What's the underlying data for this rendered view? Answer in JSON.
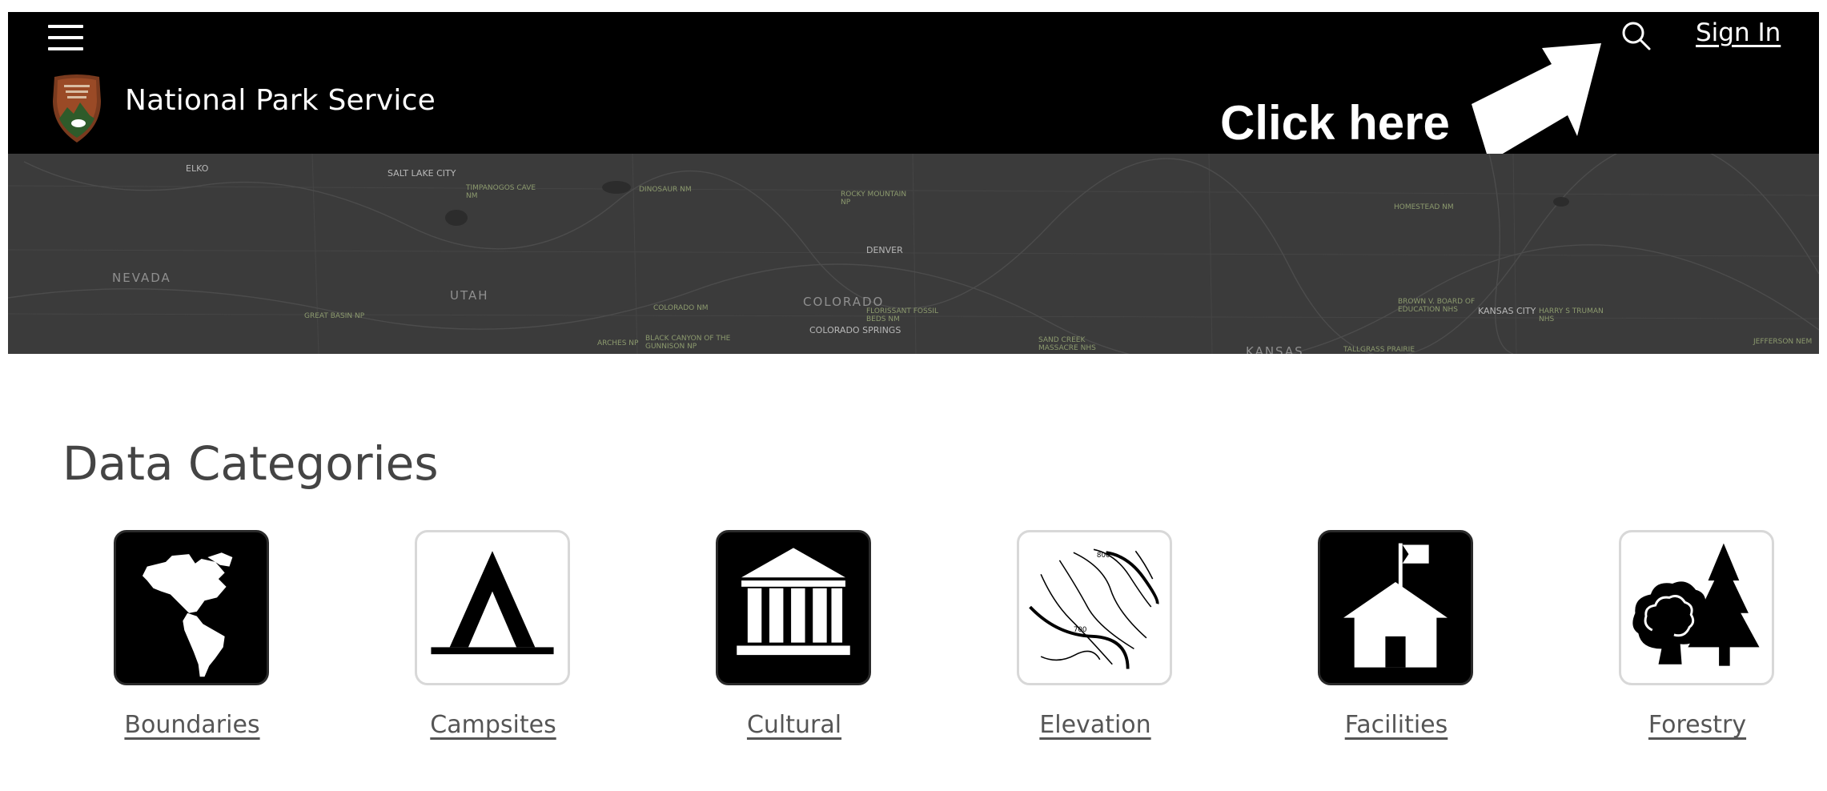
{
  "header": {
    "site_title": "National Park Service",
    "sign_in_label": "Sign In",
    "annotation_label": "Click here",
    "colors": {
      "background": "#000000",
      "text": "#ffffff"
    },
    "icons": [
      "menu-icon",
      "nps-arrowhead-logo",
      "search-icon",
      "arrow-pointer"
    ]
  },
  "map": {
    "state_labels": [
      "NEVADA",
      "UTAH",
      "COLORADO",
      "KANSAS"
    ],
    "city_labels": [
      "ELKO",
      "SALT LAKE CITY",
      "DENVER",
      "COLORADO SPRINGS",
      "KANSAS CITY"
    ],
    "park_labels": [
      "TIMPANOGOS CAVE NM",
      "DINOSAUR NM",
      "ROCKY MOUNTAIN NP",
      "HOMESTEAD NM",
      "GREAT BASIN NP",
      "COLORADO NM",
      "FLORISSANT FOSSIL BEDS NM",
      "BROWN V. BOARD OF EDUCATION NHS",
      "HARRY S TRUMAN NHS",
      "ARCHES NP",
      "BLACK CANYON OF THE GUNNISON NP",
      "SAND CREEK MASSACRE NHS",
      "TALLGRASS PRAIRIE",
      "JEFFERSON NEM"
    ],
    "colors": {
      "background": "#3b3b3b"
    }
  },
  "main": {
    "section_title": "Data Categories",
    "categories": [
      {
        "label": "Boundaries",
        "icon": "globe-americas-icon",
        "style": "dark"
      },
      {
        "label": "Campsites",
        "icon": "tent-icon",
        "style": "light"
      },
      {
        "label": "Cultural",
        "icon": "museum-building-icon",
        "style": "dark"
      },
      {
        "label": "Elevation",
        "icon": "topographic-contour-icon",
        "style": "light",
        "contour_values": [
          "800",
          "700"
        ]
      },
      {
        "label": "Facilities",
        "icon": "ranger-station-flag-icon",
        "style": "dark"
      },
      {
        "label": "Forestry",
        "icon": "trees-icon",
        "style": "light"
      }
    ]
  }
}
